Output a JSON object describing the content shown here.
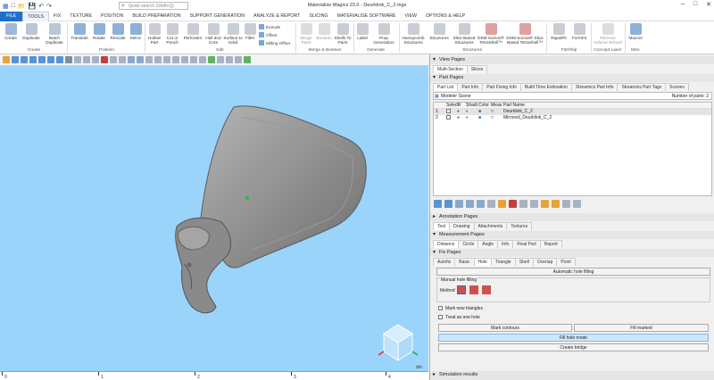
{
  "window": {
    "title": "Materialise Magics 23.0 - Deurklink_C_2.mgx",
    "search_placeholder": "Quick search (Shift+Q)"
  },
  "menu": [
    "FILE",
    "TOOLS",
    "FIX",
    "TEXTURE",
    "POSITION",
    "BUILD PREPARATION",
    "SUPPORT GENERATION",
    "ANALYZE & REPORT",
    "SLICING",
    "MATERIALISE SOFTWARE",
    "VIEW",
    "OPTIONS & HELP"
  ],
  "ribbon": {
    "create": {
      "create": "Create",
      "duplicate": "Duplicate",
      "batch": "Batch Duplicate",
      "group": "Create"
    },
    "position": {
      "translate": "Translate",
      "rotate": "Rotate",
      "rescale": "Rescale",
      "mirror": "Mirror",
      "group": "Position"
    },
    "edit": {
      "hollow": "Hollow Part",
      "cut": "Cut or Punch",
      "perforator": "Perforator",
      "hull": "Hull and Core",
      "surface": "Surface to Solid",
      "fillet": "Fillet",
      "extrude": "Extrude",
      "offset": "Offset",
      "milling": "Milling Offset",
      "group": "Edit"
    },
    "merge": {
      "merge": "Merge Parts",
      "boolean": "Boolean",
      "shells": "Shells To Parts",
      "group": "Merge & Boolean"
    },
    "generate": {
      "label": "Label",
      "prop": "Prop Generation",
      "group": "Generate"
    },
    "structures": {
      "honeycomb": "Honeycomb Structures",
      "structures": "Structures",
      "slice": "Slice Based Structures",
      "dsm1": "DSM Somos® TetraShell™",
      "dsm2": "DSM Somos® Slice Based TetraShell™",
      "group": "Structures"
    },
    "fit": {
      "rapidfit": "RapidFit",
      "formfit": "FormFit",
      "group": "Fit2Ship"
    },
    "concept": {
      "remove": "Remove Volume Wizard",
      "group": "Concept Laser"
    },
    "misc": {
      "macros": "Macros",
      "group": "Misc"
    }
  },
  "view_pages": {
    "header": "View Pages",
    "tabs": [
      "Multi-Section",
      "Slices"
    ]
  },
  "part_pages": {
    "header": "Part Pages",
    "tabs": [
      "Part List",
      "Part Info",
      "Part Fixing Info",
      "Build Time Estimation",
      "Streamics Part Info",
      "Streamics Part Tags",
      "Scenes"
    ],
    "scene": "Modeler Scene",
    "parts_label": "Number of parts:",
    "parts_count": "2",
    "columns": [
      "Select",
      "Vi",
      "Shadi",
      "Color",
      "Meas",
      "Part Name"
    ],
    "rows": [
      {
        "num": "1",
        "name": "Deurklink_C_2"
      },
      {
        "num": "2",
        "name": "Mirrored_Deurklink_C_2"
      }
    ]
  },
  "annotation_pages": {
    "header": "Annotation Pages",
    "tabs": [
      "Text",
      "Drawing",
      "Attachments",
      "Textures"
    ]
  },
  "measurement_pages": {
    "header": "Measurement Pages",
    "tabs": [
      "Distance",
      "Circle",
      "Angle",
      "Info",
      "Final Part",
      "Report"
    ]
  },
  "fix_pages": {
    "header": "Fix Pages",
    "tabs": [
      "Autofix",
      "Basic",
      "Hole",
      "Triangle",
      "Shell",
      "Overlap",
      "Point"
    ],
    "auto_hole": "Automatic hole filling",
    "manual_label": "Manual hole filling",
    "method": "Method",
    "mark_new": "Mark new triangles",
    "treat_one": "Treat as one hole",
    "mark_contours": "Mark contours",
    "fill_marked": "Fill marked",
    "fill_mode": "Fill hole mode",
    "create_bridge": "Create bridge"
  },
  "simulation": {
    "header": "Simulation results"
  },
  "ruler": {
    "labels": [
      "0",
      "1",
      "2",
      "3",
      "4"
    ],
    "unit": "dm"
  },
  "colors": {
    "viewport": "#9ad4fb",
    "accent": "#1e6fc9",
    "part": "#8a8a8a"
  }
}
